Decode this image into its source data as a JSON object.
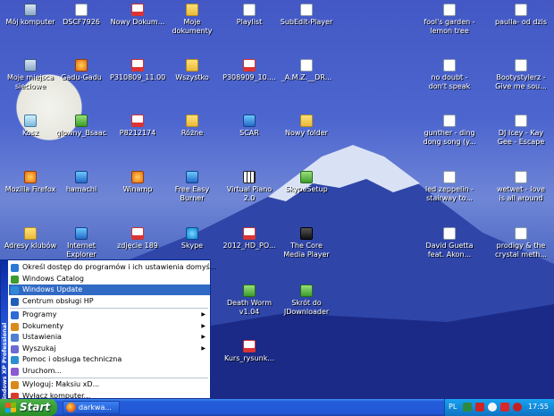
{
  "desktop": {
    "icons": [
      {
        "label": "Mój komputer",
        "icon": "my-computer-icon"
      },
      {
        "label": "DSCF7926",
        "icon": "image-file-icon"
      },
      {
        "label": "Nowy Dokum...",
        "icon": "pdf-file-icon"
      },
      {
        "label": "Moje dokumenty",
        "icon": "folder-icon"
      },
      {
        "label": "Playlist",
        "icon": "document-icon"
      },
      {
        "label": "SubEdit-Player",
        "icon": "document-icon"
      },
      {
        "label": "fool's garden - lemon tree",
        "icon": "audio-file-icon"
      },
      {
        "label": "paulla- od dzis",
        "icon": "audio-file-icon"
      },
      {
        "label": "Moje miejsca sieciowe",
        "icon": "network-icon"
      },
      {
        "label": "Gadu-Gadu",
        "icon": "gadu-gadu-icon"
      },
      {
        "label": "P310809_11.00",
        "icon": "pdf-file-icon"
      },
      {
        "label": "Wszystko",
        "icon": "folder-icon"
      },
      {
        "label": "P308909_10....",
        "icon": "pdf-file-icon"
      },
      {
        "label": "_A.M.Z.__DR...",
        "icon": "document-icon"
      },
      {
        "label": "no doubt - don't speak",
        "icon": "audio-file-icon"
      },
      {
        "label": "Bootystylerz - Give me sou...",
        "icon": "audio-file-icon"
      },
      {
        "label": "Kosz",
        "icon": "recycle-bin-icon"
      },
      {
        "label": "glowny_Bsaac",
        "icon": "app-icon"
      },
      {
        "label": "P8212174",
        "icon": "pdf-file-icon"
      },
      {
        "label": "Różne",
        "icon": "folder-icon"
      },
      {
        "label": "SCAR",
        "icon": "scar-icon"
      },
      {
        "label": "Nowy folder",
        "icon": "folder-icon"
      },
      {
        "label": "gunther - ding dong song (y...",
        "icon": "audio-file-icon"
      },
      {
        "label": "DJ Icey - Kay Gee - Escape",
        "icon": "audio-file-icon"
      },
      {
        "label": "Mozilla Firefox",
        "icon": "firefox-icon"
      },
      {
        "label": "hamachi",
        "icon": "hamachi-icon"
      },
      {
        "label": "Winamp",
        "icon": "winamp-icon"
      },
      {
        "label": "Free Easy Burner",
        "icon": "burner-icon"
      },
      {
        "label": "Virtual Piano 2.0",
        "icon": "piano-icon"
      },
      {
        "label": "SkypeSetup",
        "icon": "setup-icon"
      },
      {
        "label": "led zeppelin - stairway to...",
        "icon": "audio-file-icon"
      },
      {
        "label": "wetwet - love is all around",
        "icon": "audio-file-icon"
      },
      {
        "label": "Adresy klubów",
        "icon": "folder-icon"
      },
      {
        "label": "Internet Explorer",
        "icon": "internet-explorer-icon"
      },
      {
        "label": "zdjęcie 189",
        "icon": "pdf-file-icon"
      },
      {
        "label": "Skype",
        "icon": "skype-icon"
      },
      {
        "label": "2012_HD_PO...",
        "icon": "pdf-file-icon"
      },
      {
        "label": "The Core Media Player",
        "icon": "media-player-icon"
      },
      {
        "label": "David Guetta feat. Akon...",
        "icon": "audio-file-icon"
      },
      {
        "label": "prodigy & the crystal meth...",
        "icon": "audio-file-icon"
      },
      {
        "label": "Death Worm v1.04",
        "icon": "app-icon"
      },
      {
        "label": "Skrót do JDownloader",
        "icon": "jdownloader-icon"
      },
      {
        "label": "Kurs_rysunk...",
        "icon": "pdf-file-icon"
      }
    ]
  },
  "start_menu": {
    "banner": "Windows XP Professional",
    "top_items": [
      {
        "label": "Określ dostęp do programów i ich ustawienia domyś...",
        "icon": "program-access-icon"
      },
      {
        "label": "Windows Catalog",
        "icon": "windows-catalog-icon"
      },
      {
        "label": "Windows Update",
        "icon": "windows-update-icon"
      },
      {
        "label": "Centrum obsługi HP",
        "icon": "hp-icon"
      }
    ],
    "main_items": [
      {
        "label": "Programy",
        "icon": "programs-icon",
        "arrow": "▶"
      },
      {
        "label": "Dokumenty",
        "icon": "documents-icon",
        "arrow": "▶"
      },
      {
        "label": "Ustawienia",
        "icon": "settings-icon",
        "arrow": "▶"
      },
      {
        "label": "Wyszukaj",
        "icon": "search-icon",
        "arrow": "▶"
      },
      {
        "label": "Pomoc i obsługa techniczna",
        "icon": "help-icon",
        "arrow": ""
      },
      {
        "label": "Uruchom...",
        "icon": "run-icon",
        "arrow": ""
      }
    ],
    "bottom_items": [
      {
        "label": "Wyloguj: Maksiu xD...",
        "icon": "log-off-icon"
      },
      {
        "label": "Wyłącz komputer...",
        "icon": "shut-down-icon"
      }
    ]
  },
  "taskbar": {
    "start_label": "Start",
    "tasks": [
      {
        "label": "darkwa...",
        "icon": "firefox-icon"
      }
    ],
    "tray": {
      "language": "PL",
      "clock": "17:55"
    }
  }
}
